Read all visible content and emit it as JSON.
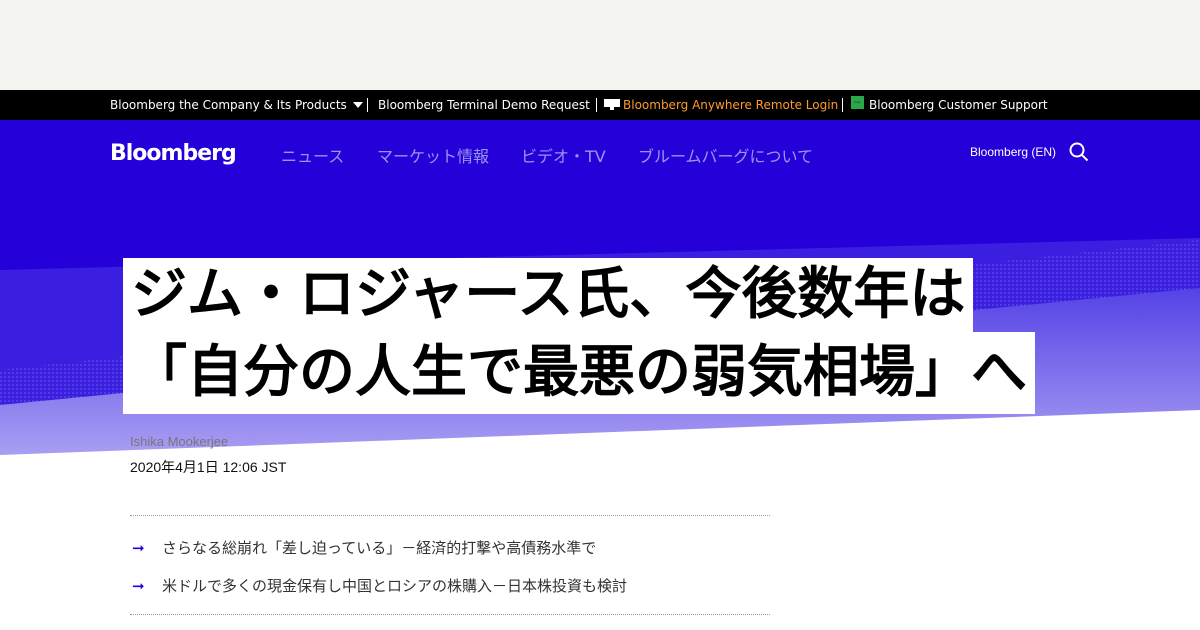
{
  "top_bar": {
    "company_link": "Bloomberg the Company & Its Products",
    "terminal_demo": "Bloomberg Terminal Demo Request",
    "anywhere_login": "Bloomberg Anywhere Remote Login",
    "customer_support": "Bloomberg Customer Support",
    "help_icon_text": "Help",
    "colors": {
      "anywhere_login": "#ff9a2e",
      "help_icon": "#2aa84a"
    }
  },
  "header": {
    "logo": "Bloomberg",
    "nav": [
      "ニュース",
      "マーケット情報",
      "ビデオ・TV",
      "ブルームバーグについて"
    ],
    "language": "Bloomberg (EN)",
    "search_icon": "search-icon"
  },
  "article": {
    "headline_line1": "ジム・ロジャース氏、今後数年は",
    "headline_line2": "「自分の人生で最悪の弱気相場」へ",
    "author": "Ishika Mookerjee",
    "date": "2020年4月1日 12:06 JST",
    "bullets": [
      "さらなる総崩れ「差し迫っている」－経済的打撃や高債務水準で",
      "米ドルで多くの現金保有し中国とロシアの株購入－日本株投資も検討"
    ],
    "bullet_icon": "arrow-right-icon"
  },
  "colors": {
    "hero_blue": "#2600d8",
    "ad_background": "#f3f3f0"
  }
}
